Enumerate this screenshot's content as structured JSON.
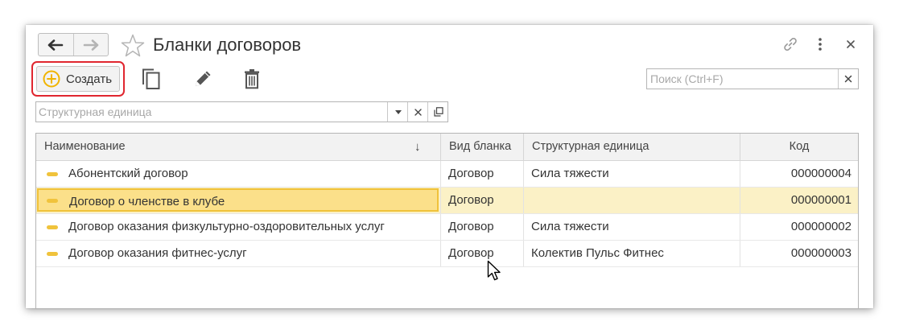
{
  "window": {
    "title": "Бланки договоров"
  },
  "toolbar": {
    "create_label": "Создать",
    "search_placeholder": "Поиск (Ctrl+F)"
  },
  "filter": {
    "placeholder": "Структурная единица"
  },
  "table": {
    "columns": [
      "Наименование",
      "Вид бланка",
      "Структурная единица",
      "Код"
    ],
    "sort_indicator": "↓",
    "rows": [
      {
        "name": "Абонентский договор",
        "kind": "Договор",
        "unit": "Сила тяжести",
        "code": "000000004"
      },
      {
        "name": "Договор о членстве в клубе",
        "kind": "Договор",
        "unit": "",
        "code": "000000001"
      },
      {
        "name": "Договор оказания физкультурно-оздоровительных услуг",
        "kind": "Договор",
        "unit": "Сила тяжести",
        "code": "000000002"
      },
      {
        "name": "Договор оказания фитнес-услуг",
        "kind": "Договор",
        "unit": "Колектив Пульс Фитнес",
        "code": "000000003"
      }
    ],
    "selected_row": 1
  },
  "colors": {
    "accent_highlight": "#e0262f",
    "create_icon": "#f0b400",
    "selection_bg": "#fbf1c6",
    "focus_cell": "#fbe08a",
    "row_marker": "#f0c33c"
  }
}
